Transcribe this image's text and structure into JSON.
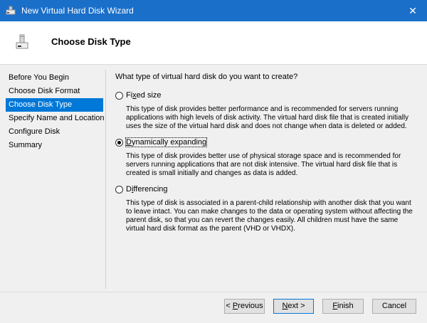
{
  "window": {
    "title": "New Virtual Hard Disk Wizard",
    "close_glyph": "✕",
    "app_icon": "hard-disk-icon"
  },
  "header": {
    "title": "Choose Disk Type",
    "icon": "hard-disk-icon"
  },
  "sidebar": {
    "items": [
      {
        "label": "Before You Begin",
        "selected": false
      },
      {
        "label": "Choose Disk Format",
        "selected": false
      },
      {
        "label": "Choose Disk Type",
        "selected": true
      },
      {
        "label": "Specify Name and Location",
        "selected": false
      },
      {
        "label": "Configure Disk",
        "selected": false
      },
      {
        "label": "Summary",
        "selected": false
      }
    ]
  },
  "main": {
    "question": "What type of virtual hard disk do you want to create?",
    "options": [
      {
        "label_pre": "Fi",
        "label_key": "x",
        "label_post": "ed size",
        "checked": false,
        "description": "This type of disk provides better performance and is recommended for servers running applications with high levels of disk activity. The virtual hard disk file that is created initially uses the size of the virtual hard disk and does not change when data is deleted or added."
      },
      {
        "label_pre": "",
        "label_key": "D",
        "label_post": "ynamically expanding",
        "checked": true,
        "description": "This type of disk provides better use of physical storage space and is recommended for servers running applications that are not disk intensive. The virtual hard disk file that is created is small initially and changes as data is added."
      },
      {
        "label_pre": "D",
        "label_key": "i",
        "label_post": "fferencing",
        "checked": false,
        "description": "This type of disk is associated in a parent-child relationship with another disk that you want to leave intact. You can make changes to the data or operating system without affecting the parent disk, so that you can revert the changes easily. All children must have the same virtual hard disk format as the parent (VHD or VHDX)."
      }
    ]
  },
  "buttons": {
    "previous_pre": "< ",
    "previous_key": "P",
    "previous_post": "revious",
    "next_pre": "",
    "next_key": "N",
    "next_post": "ext >",
    "finish_pre": "",
    "finish_key": "F",
    "finish_post": "inish",
    "cancel": "Cancel"
  }
}
